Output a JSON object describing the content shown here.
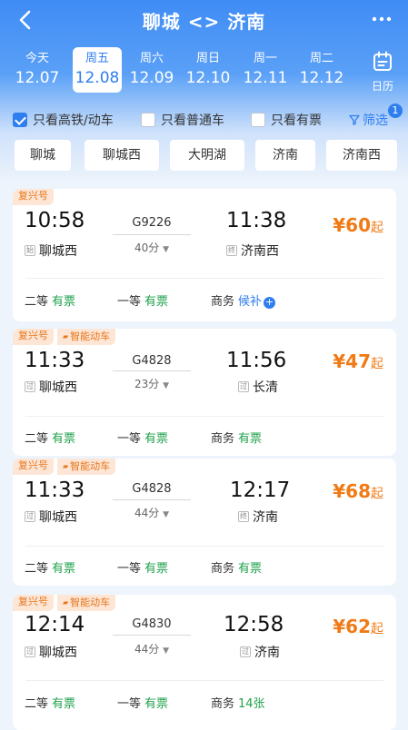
{
  "header": {
    "title": "聊城 <> 济南"
  },
  "dates": [
    {
      "weekday": "今天",
      "date": "12.07"
    },
    {
      "weekday": "周五",
      "date": "12.08"
    },
    {
      "weekday": "周六",
      "date": "12.09"
    },
    {
      "weekday": "周日",
      "date": "12.10"
    },
    {
      "weekday": "周一",
      "date": "12.11"
    },
    {
      "weekday": "周二",
      "date": "12.12"
    }
  ],
  "calendar_label": "日历",
  "filters": {
    "gaotie": "只看高铁/动车",
    "putong": "只看普通车",
    "youpiao": "只看有票",
    "screen": "筛选",
    "badge": "1"
  },
  "stations": [
    "聊城",
    "聊城西",
    "大明湖",
    "济南",
    "济南西"
  ],
  "trains": [
    {
      "tags": [
        "复兴号"
      ],
      "dep_time": "10:58",
      "arr_time": "11:38",
      "dep_mark": "始",
      "arr_mark": "终",
      "dep_station": "聊城西",
      "arr_station": "济南西",
      "train_no": "G9226",
      "duration": "40分",
      "price_symbol": "¥",
      "price": "60",
      "price_suffix": "起",
      "seats": [
        {
          "name": "二等",
          "status": "有票"
        },
        {
          "name": "一等",
          "status": "有票"
        },
        {
          "name": "商务",
          "status": "候补"
        }
      ]
    },
    {
      "tags": [
        "复兴号",
        "智能动车"
      ],
      "dep_time": "11:33",
      "arr_time": "11:56",
      "dep_mark": "过",
      "arr_mark": "过",
      "dep_station": "聊城西",
      "arr_station": "长清",
      "train_no": "G4828",
      "duration": "23分",
      "price_symbol": "¥",
      "price": "47",
      "price_suffix": "起",
      "seats": [
        {
          "name": "二等",
          "status": "有票"
        },
        {
          "name": "一等",
          "status": "有票"
        },
        {
          "name": "商务",
          "status": "有票"
        }
      ]
    },
    {
      "tags": [
        "复兴号",
        "智能动车"
      ],
      "dep_time": "11:33",
      "arr_time": "12:17",
      "dep_mark": "过",
      "arr_mark": "终",
      "dep_station": "聊城西",
      "arr_station": "济南",
      "train_no": "G4828",
      "duration": "44分",
      "price_symbol": "¥",
      "price": "68",
      "price_suffix": "起",
      "seats": [
        {
          "name": "二等",
          "status": "有票"
        },
        {
          "name": "一等",
          "status": "有票"
        },
        {
          "name": "商务",
          "status": "有票"
        }
      ]
    },
    {
      "tags": [
        "复兴号",
        "智能动车"
      ],
      "dep_time": "12:14",
      "arr_time": "12:58",
      "dep_mark": "过",
      "arr_mark": "过",
      "dep_station": "聊城西",
      "arr_station": "济南",
      "train_no": "G4830",
      "duration": "44分",
      "price_symbol": "¥",
      "price": "62",
      "price_suffix": "起",
      "seats": [
        {
          "name": "二等",
          "status": "有票"
        },
        {
          "name": "一等",
          "status": "有票"
        },
        {
          "name": "商务",
          "status": "14张"
        }
      ]
    }
  ],
  "colors": {
    "primary": "#2f7ef0",
    "price": "#f07b16",
    "available": "#1fa24b",
    "tag_bg": "#fde6d6"
  }
}
